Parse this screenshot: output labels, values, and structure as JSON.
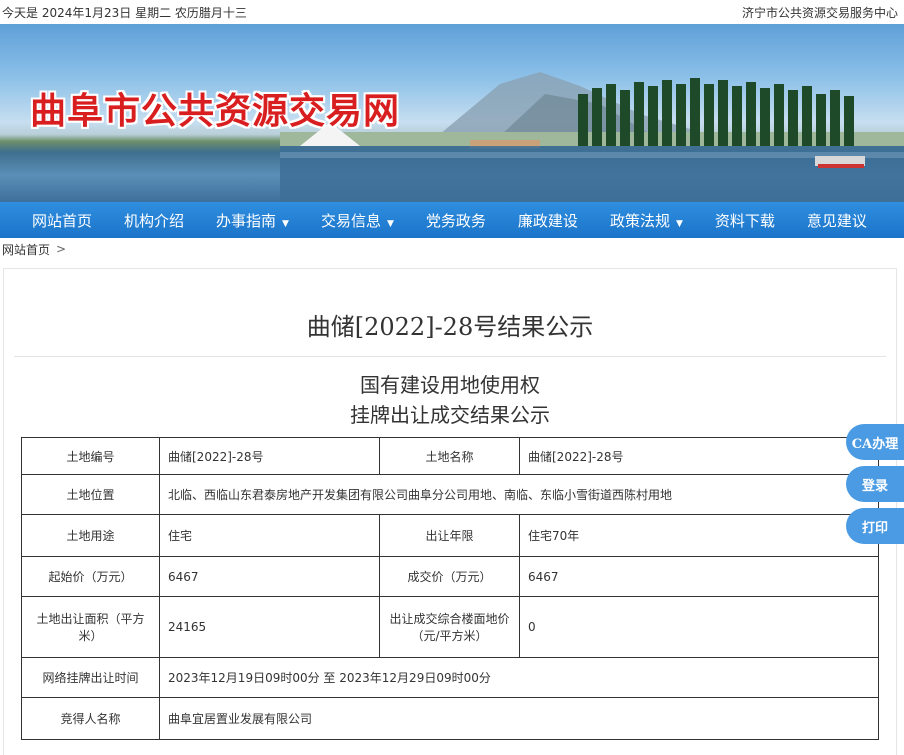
{
  "topbar": {
    "date_text": "今天是  2024年1月23日  星期二  农历腊月十三",
    "org": "济宁市公共资源交易服务中心"
  },
  "banner": {
    "site_title": "曲阜市公共资源交易网"
  },
  "nav": {
    "items": [
      {
        "label": "网站首页",
        "dropdown": false
      },
      {
        "label": "机构介绍",
        "dropdown": false
      },
      {
        "label": "办事指南",
        "dropdown": true
      },
      {
        "label": "交易信息",
        "dropdown": true
      },
      {
        "label": "党务政务",
        "dropdown": false
      },
      {
        "label": "廉政建设",
        "dropdown": false
      },
      {
        "label": "政策法规",
        "dropdown": true
      },
      {
        "label": "资料下载",
        "dropdown": false
      },
      {
        "label": "意见建议",
        "dropdown": false
      }
    ]
  },
  "breadcrumb": {
    "home": "网站首页",
    "sep": ">"
  },
  "doc": {
    "title": "曲储[2022]-28号结果公示",
    "subtitle_line1": "国有建设用地使用权",
    "subtitle_line2": "挂牌出让成交结果公示"
  },
  "table": {
    "land_no_label": "土地编号",
    "land_no": "曲储[2022]-28号",
    "land_name_label": "土地名称",
    "land_name": "曲储[2022]-28号",
    "location_label": "土地位置",
    "location": "北临、西临山东君泰房地产开发集团有限公司曲阜分公司用地、南临、东临小雪街道西陈村用地",
    "use_label": "土地用途",
    "use": "住宅",
    "term_label": "出让年限",
    "term": "住宅70年",
    "start_price_label": "起始价（万元）",
    "start_price": "6467",
    "deal_price_label": "成交价（万元）",
    "deal_price": "6467",
    "area_label": "土地出让面积（平方米）",
    "area": "24165",
    "floor_price_label": "出让成交综合楼面地价（元/平方米）",
    "floor_price": "0",
    "time_label": "网络挂牌出让时间",
    "time": "2023年12月19日09时00分  至  2023年12月29日09时00分",
    "winner_label": "竞得人名称",
    "winner": "曲阜宜居置业发展有限公司"
  },
  "side": {
    "ca": "CA办理",
    "login": "登录",
    "print": "打印"
  }
}
